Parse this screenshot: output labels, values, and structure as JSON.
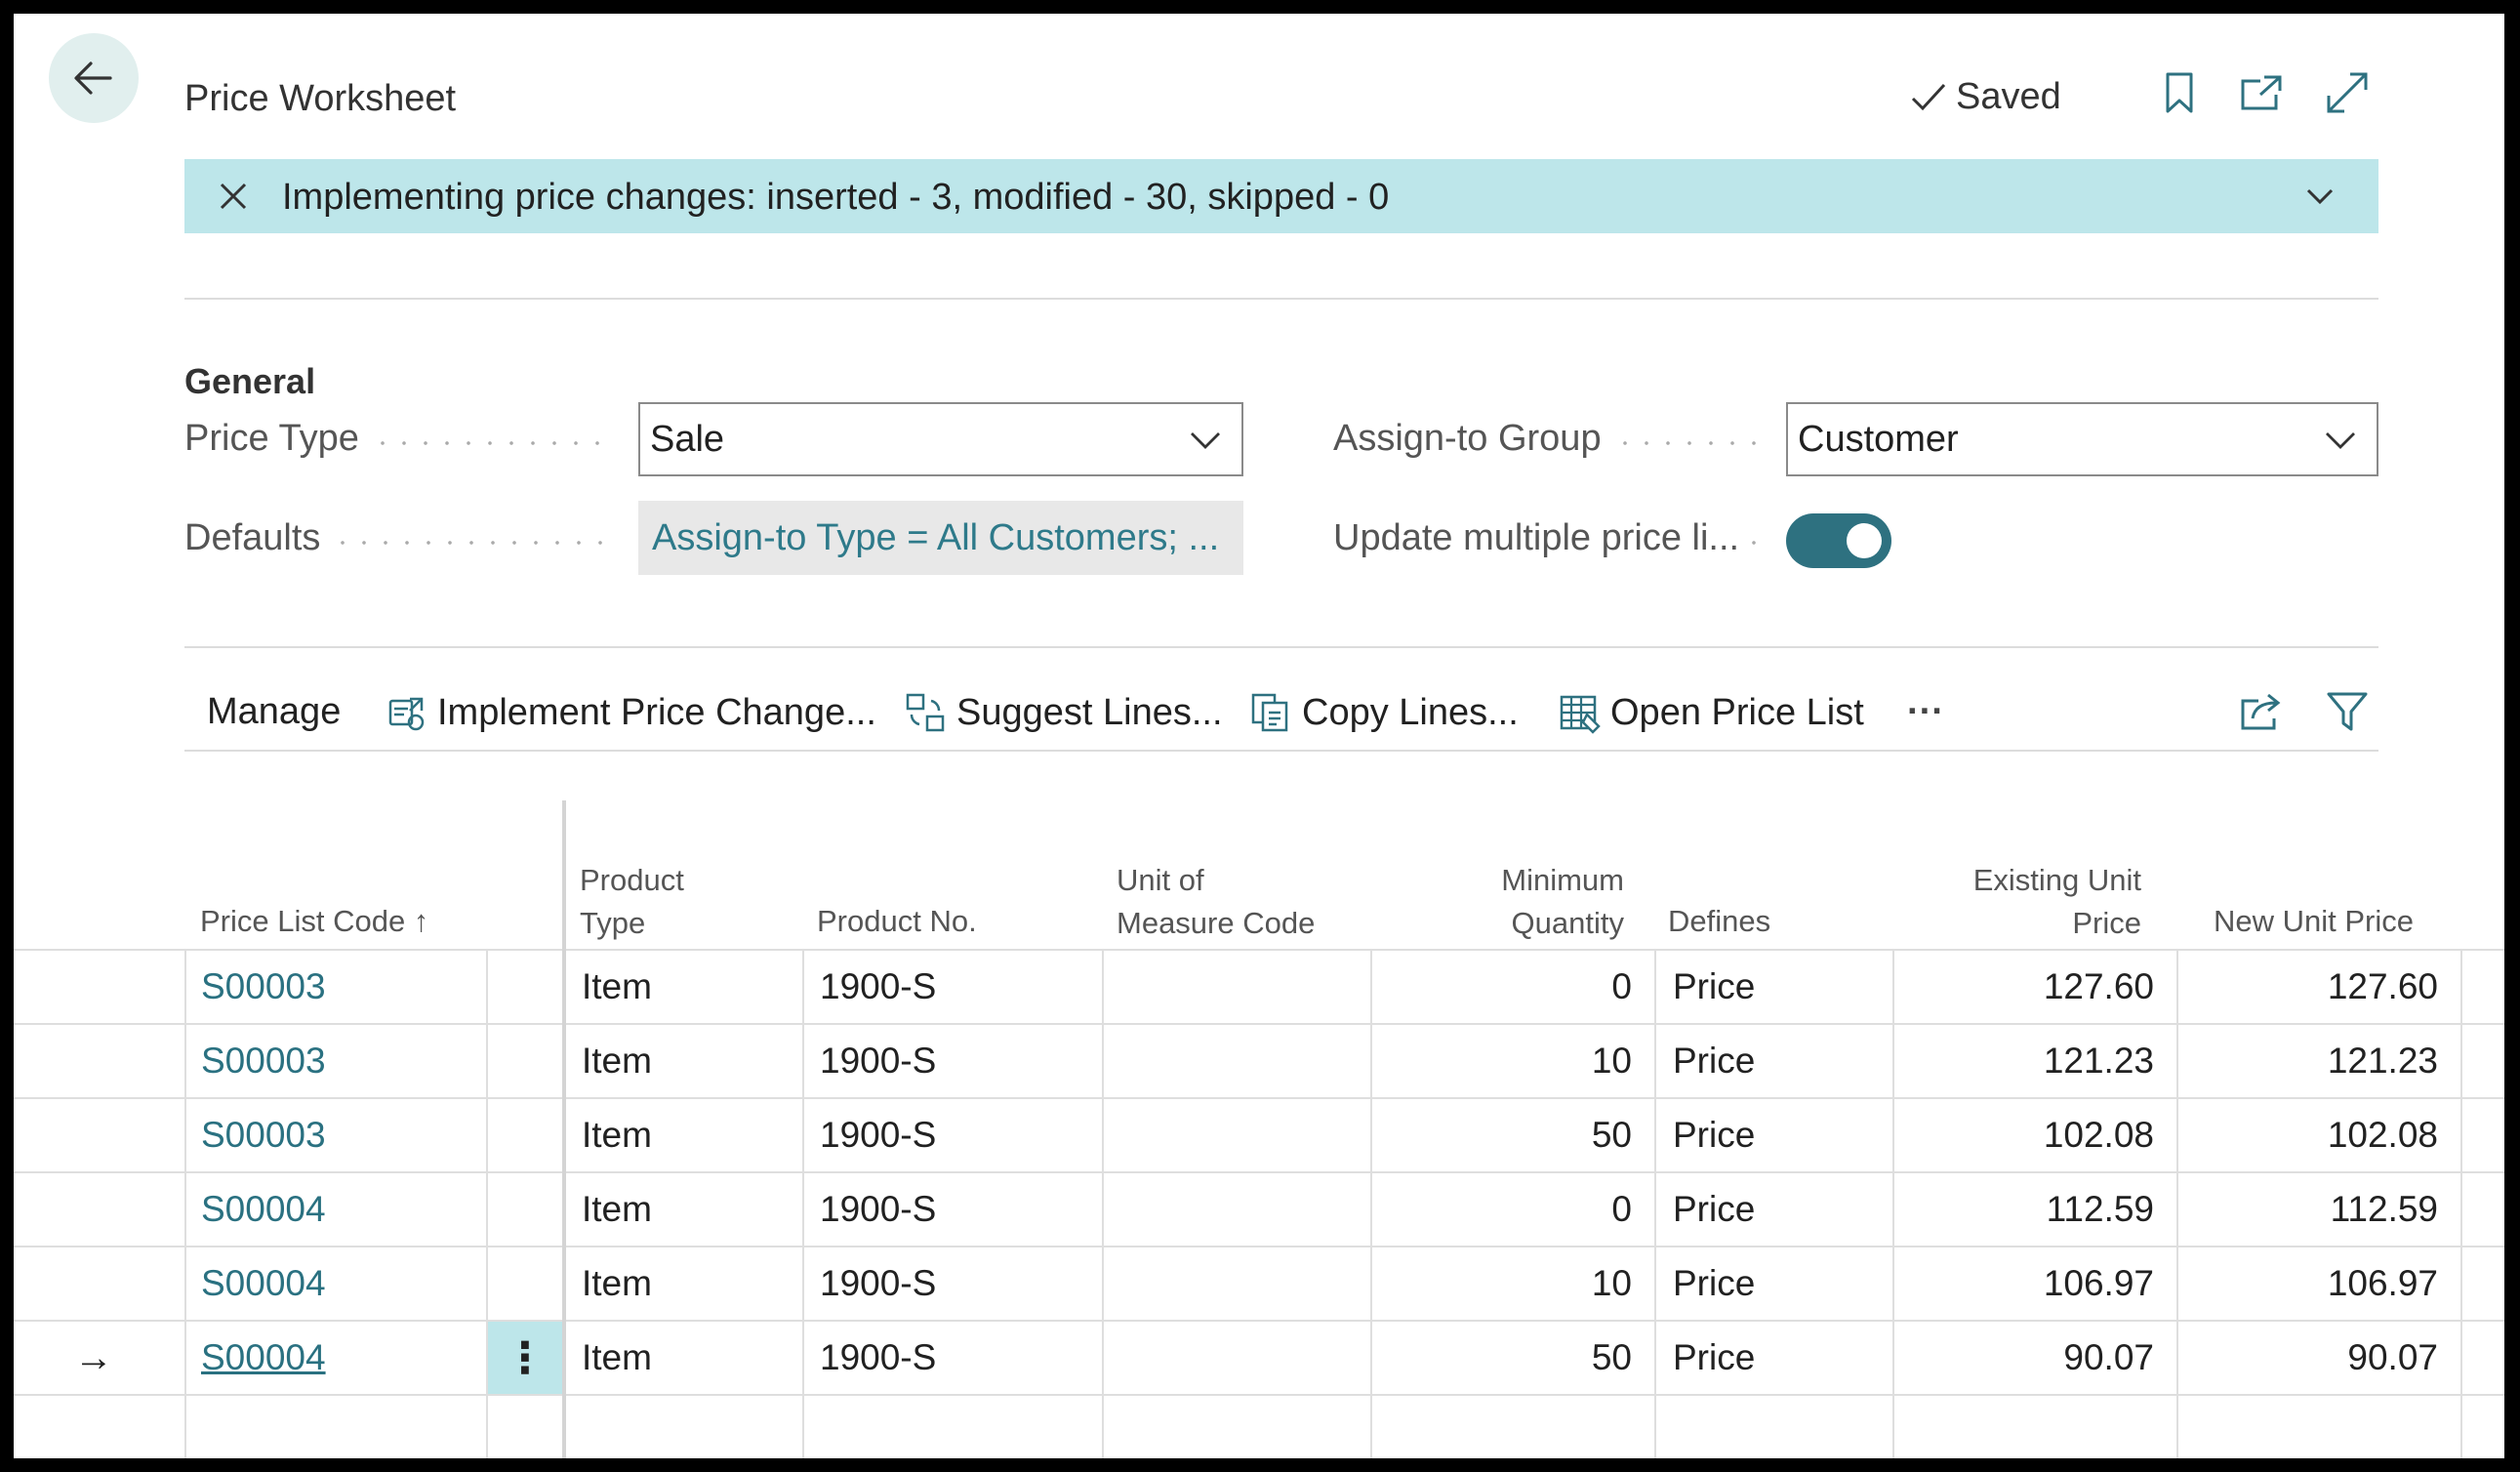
{
  "header": {
    "title": "Price Worksheet",
    "saved_label": "Saved",
    "icons": [
      "back-arrow-icon",
      "checkmark-icon",
      "bookmark-icon",
      "open-new-window-icon",
      "expand-icon"
    ]
  },
  "notification": {
    "text": "Implementing price changes: inserted - 3, modified - 30, skipped - 0",
    "background": "#bde6ea"
  },
  "general": {
    "title": "General",
    "price_type_label": "Price Type",
    "price_type_value": "Sale",
    "defaults_label": "Defaults",
    "defaults_value": "Assign-to Type = All Customers; ...",
    "assign_group_label": "Assign-to Group",
    "assign_group_value": "Customer",
    "update_multiple_label": "Update multiple price li...",
    "update_multiple_on": true
  },
  "actions": {
    "manage": "Manage",
    "implement": "Implement Price Change...",
    "suggest": "Suggest Lines...",
    "copy": "Copy Lines...",
    "open_price_list": "Open Price List",
    "more": "···"
  },
  "table": {
    "columns": {
      "price_list_code": "Price List Code",
      "sort_indicator": "↑",
      "product_type_1": "Product",
      "product_type_2": "Type",
      "product_no": "Product No.",
      "uom_1": "Unit of",
      "uom_2": "Measure Code",
      "min_qty_1": "Minimum",
      "min_qty_2": "Quantity",
      "defines": "Defines",
      "existing_1": "Existing Unit",
      "existing_2": "Price",
      "new_price": "New Unit Price"
    },
    "rows": [
      {
        "code": "S00003",
        "product_type": "Item",
        "product_no": "1900-S",
        "uom": "",
        "min_qty": "0",
        "defines": "Price",
        "existing": "127.60",
        "new": "127.60"
      },
      {
        "code": "S00003",
        "product_type": "Item",
        "product_no": "1900-S",
        "uom": "",
        "min_qty": "10",
        "defines": "Price",
        "existing": "121.23",
        "new": "121.23"
      },
      {
        "code": "S00003",
        "product_type": "Item",
        "product_no": "1900-S",
        "uom": "",
        "min_qty": "50",
        "defines": "Price",
        "existing": "102.08",
        "new": "102.08"
      },
      {
        "code": "S00004",
        "product_type": "Item",
        "product_no": "1900-S",
        "uom": "",
        "min_qty": "0",
        "defines": "Price",
        "existing": "112.59",
        "new": "112.59"
      },
      {
        "code": "S00004",
        "product_type": "Item",
        "product_no": "1900-S",
        "uom": "",
        "min_qty": "10",
        "defines": "Price",
        "existing": "106.97",
        "new": "106.97"
      },
      {
        "code": "S00004",
        "product_type": "Item",
        "product_no": "1900-S",
        "uom": "",
        "min_qty": "50",
        "defines": "Price",
        "existing": "90.07",
        "new": "90.07"
      }
    ],
    "selected_row": 5,
    "row_menu_glyph": "⋮",
    "row_pointer_glyph": "→"
  },
  "colors": {
    "accent": "#2e7180",
    "link": "#2a7181",
    "back_button_bg": "#e1efee",
    "selected_cell_bg": "#bde6ea"
  }
}
